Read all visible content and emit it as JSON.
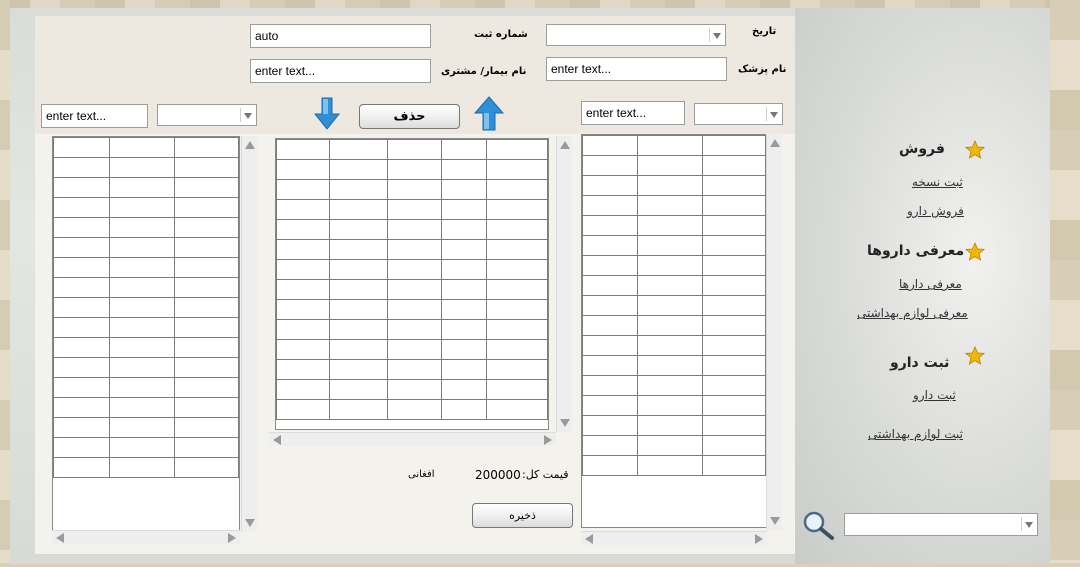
{
  "header": {
    "date_label": "تاریخ",
    "registration_no_label": "شماره ثبت",
    "registration_no_value": "auto",
    "doctor_label": "نام پزشک",
    "doctor_placeholder": "enter text...",
    "patient_label": "نام بیمار/ مشتری",
    "patient_placeholder": "enter text..."
  },
  "left_panel": {
    "search_placeholder": "enter text..."
  },
  "right_panel": {
    "search_placeholder": "enter text..."
  },
  "center": {
    "delete_label": "حذف",
    "total_label": "قیمت کل:",
    "total_value": "200000",
    "currency": "افغانی",
    "save_label": "ذخیره"
  },
  "sidebar": {
    "sections": [
      {
        "title": "فروش",
        "links": [
          "ثبت نسخه",
          "فروش دارو"
        ]
      },
      {
        "title": "معرفی داروها",
        "links": [
          "معرفی دارها",
          "معرفی لوازم بهداشتی"
        ]
      },
      {
        "title": "ثبت دارو",
        "links": [
          "ثبت دارو",
          "ثبت لوازم بهداشتی"
        ]
      }
    ]
  },
  "colors": {
    "arrow_blue": "#2e8fd6",
    "star_gold": "#f2b705"
  },
  "icons": {
    "up_arrow": "arrow-up-icon",
    "down_arrow": "arrow-down-icon",
    "search": "search-icon",
    "star": "star-icon"
  }
}
